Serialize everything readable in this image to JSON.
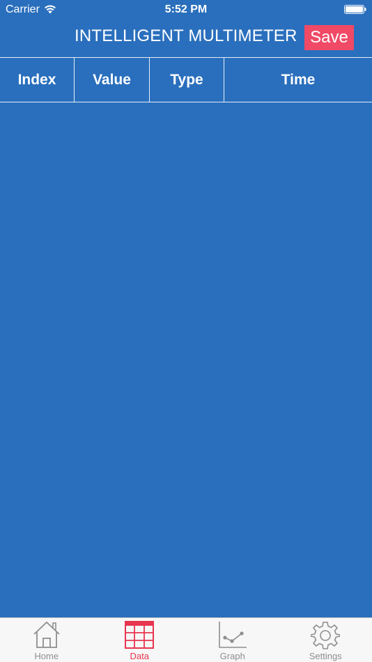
{
  "status_bar": {
    "carrier": "Carrier",
    "time": "5:52 PM"
  },
  "header": {
    "title": "INTELLIGENT MULTIMETER",
    "save_label": "Save"
  },
  "table": {
    "columns": [
      "Index",
      "Value",
      "Type",
      "Time"
    ],
    "rows": []
  },
  "tab_bar": {
    "tabs": [
      {
        "label": "Home",
        "icon": "home-icon"
      },
      {
        "label": "Data",
        "icon": "table-icon",
        "active": true
      },
      {
        "label": "Graph",
        "icon": "graph-icon"
      },
      {
        "label": "Settings",
        "icon": "gear-icon"
      }
    ]
  },
  "colors": {
    "background": "#2a6fbd",
    "accent": "#f04a66",
    "tab_inactive": "#8e8e8e",
    "tab_active": "#e8354f"
  }
}
